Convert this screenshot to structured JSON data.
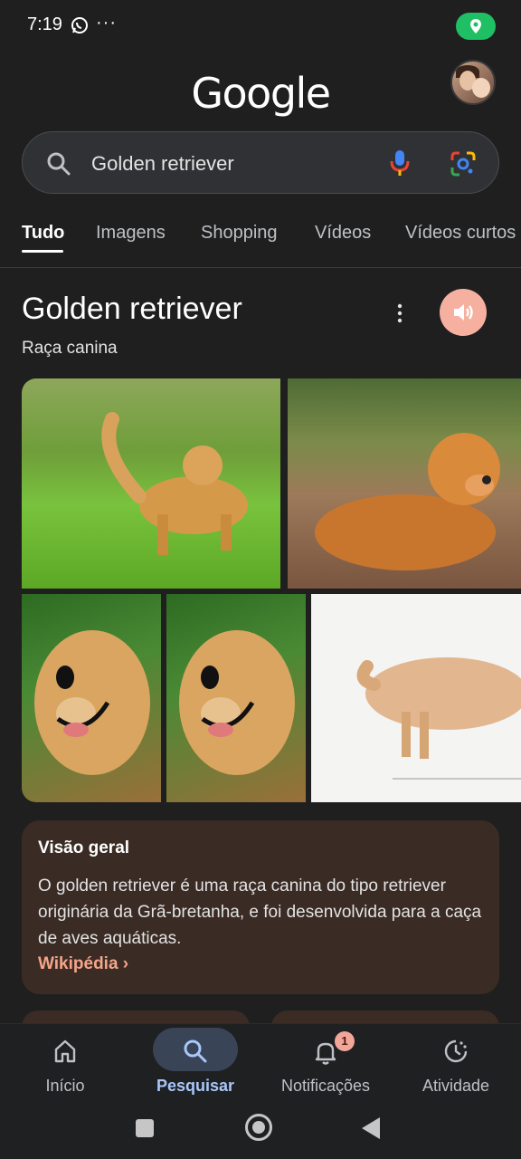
{
  "status_bar": {
    "time": "7:19",
    "more": "···",
    "location_color": "#1fbf63"
  },
  "header": {
    "logo": "Google",
    "avatar": "profile-avatar"
  },
  "search": {
    "query": "Golden retriever",
    "icons": [
      "search-icon",
      "mic-icon",
      "lens-icon"
    ]
  },
  "tabs": [
    {
      "label": "Tudo",
      "active": true
    },
    {
      "label": "Imagens"
    },
    {
      "label": "Shopping"
    },
    {
      "label": "Vídeos"
    },
    {
      "label": "Vídeos curtos"
    }
  ],
  "knowledge": {
    "title": "Golden retriever",
    "subtitle": "Raça canina",
    "speaker_color": "#f6b0a0"
  },
  "images": [
    {
      "alt": "golden-running-grass"
    },
    {
      "alt": "golden-lying-down"
    },
    {
      "alt": "golden-portrait-1"
    },
    {
      "alt": "golden-portrait-2"
    },
    {
      "alt": "golden-sketch"
    }
  ],
  "overview": {
    "heading": "Visão geral",
    "body": "O golden retriever é uma raça canina do tipo retriever originária da Grã-bretanha, e foi desenvolvida para a caça de aves aquáticas.",
    "link": "Wikipédia ›",
    "card_color": "#3a2b24",
    "link_color": "#f5a48a"
  },
  "bottom_nav": [
    {
      "label": "Início",
      "icon": "home-icon"
    },
    {
      "label": "Pesquisar",
      "icon": "search-icon",
      "active": true
    },
    {
      "label": "Notificações",
      "icon": "bell-icon",
      "badge": "1"
    },
    {
      "label": "Atividade",
      "icon": "activity-icon"
    }
  ],
  "accent_color": "#a8c7fa"
}
